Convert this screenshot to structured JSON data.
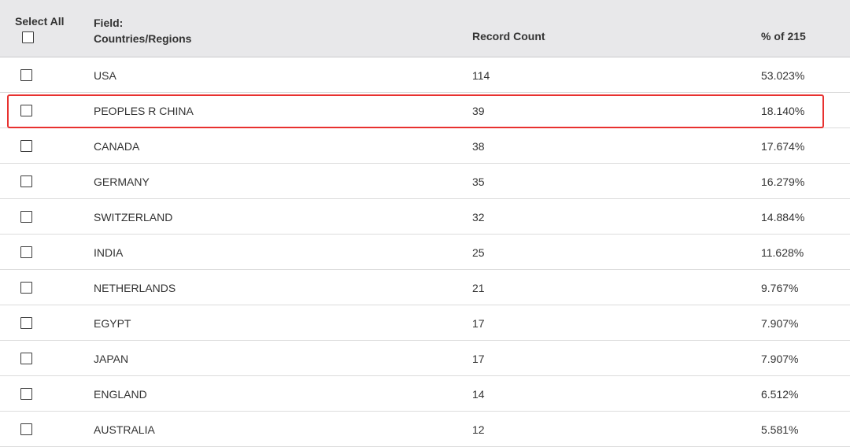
{
  "header": {
    "select_all_label": "Select All",
    "field_label": "Field:",
    "field_value": "Countries/Regions",
    "record_count_label": "Record Count",
    "percent_label": "% of 215"
  },
  "rows": [
    {
      "name": "USA",
      "count": "114",
      "percent": "53.023%"
    },
    {
      "name": "PEOPLES R CHINA",
      "count": "39",
      "percent": "18.140%"
    },
    {
      "name": "CANADA",
      "count": "38",
      "percent": "17.674%"
    },
    {
      "name": "GERMANY",
      "count": "35",
      "percent": "16.279%"
    },
    {
      "name": "SWITZERLAND",
      "count": "32",
      "percent": "14.884%"
    },
    {
      "name": "INDIA",
      "count": "25",
      "percent": "11.628%"
    },
    {
      "name": "NETHERLANDS",
      "count": "21",
      "percent": "9.767%"
    },
    {
      "name": "EGYPT",
      "count": "17",
      "percent": "7.907%"
    },
    {
      "name": "JAPAN",
      "count": "17",
      "percent": "7.907%"
    },
    {
      "name": "ENGLAND",
      "count": "14",
      "percent": "6.512%"
    },
    {
      "name": "AUSTRALIA",
      "count": "12",
      "percent": "5.581%"
    }
  ],
  "colors": {
    "header_bg": "#e8e8ea",
    "highlight_border": "#e8312f",
    "row_divider": "#dcdcdc"
  }
}
